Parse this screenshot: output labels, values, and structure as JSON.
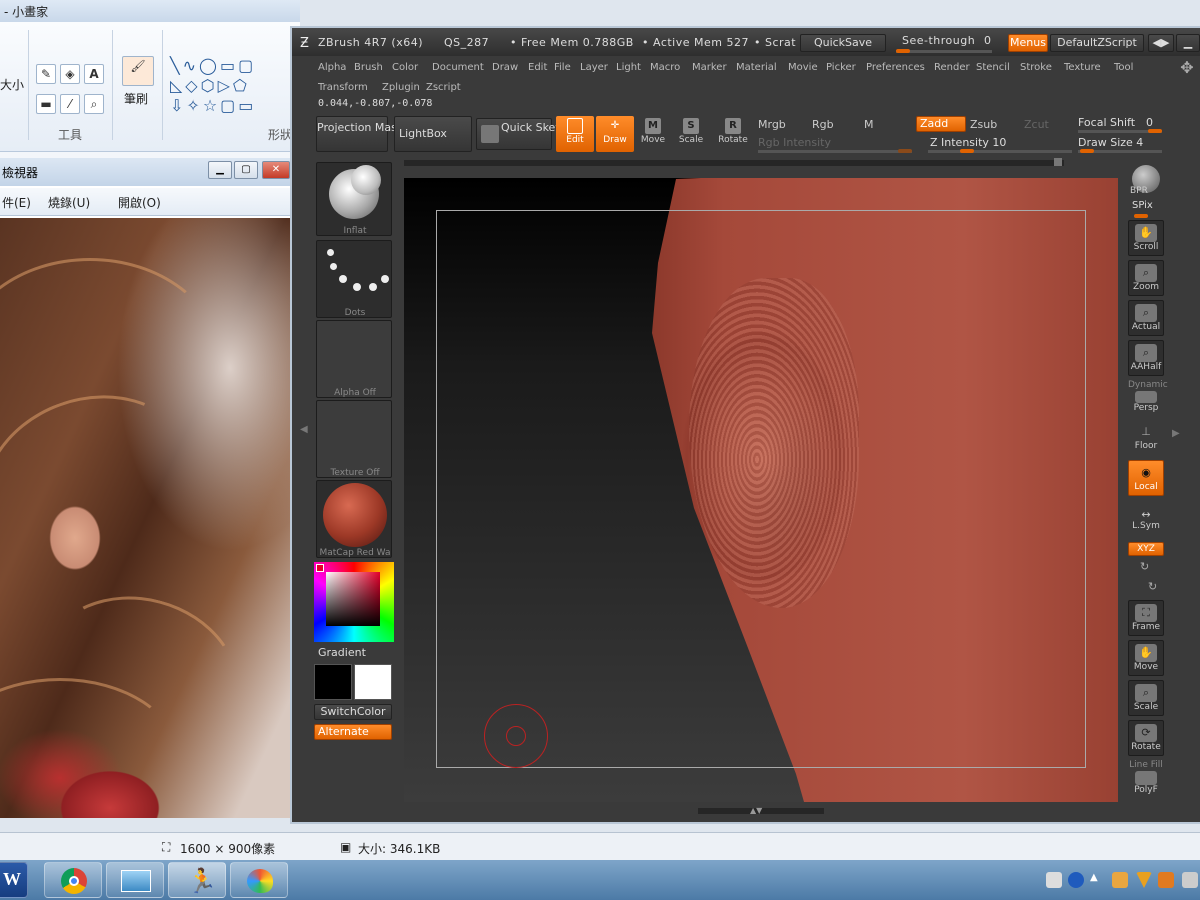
{
  "paint": {
    "title": "- 小畫家",
    "size_label": "大小",
    "brush_label": "筆刷",
    "tools_group": "工具",
    "shapes_group": "形狀"
  },
  "viewer": {
    "title": "檢視器",
    "menu": [
      "件(E)",
      "燒錄(U)",
      "開啟(O)"
    ]
  },
  "status": {
    "dimensions": "1600 × 900像素",
    "filesize": "大小: 346.1KB"
  },
  "zbrush": {
    "title": "ZBrush 4R7 (x64)",
    "qs": "QS_287",
    "free_mem": "• Free Mem 0.788GB",
    "active_mem": "• Active Mem 527",
    "scratch": "• Scrat",
    "quicksave": "QuickSave",
    "see_through": "See-through",
    "see_through_value": "0",
    "menus": "Menus",
    "default_script": "DefaultZScript",
    "menu_row1": [
      "Alpha",
      "Brush",
      "Color",
      "Document",
      "Draw",
      "Edit",
      "File",
      "Layer",
      "Light",
      "Macro",
      "Marker",
      "Material",
      "Movie",
      "Picker",
      "Preferences",
      "Render",
      "Stencil",
      "Stroke",
      "Texture",
      "Tool"
    ],
    "menu_row2": [
      "Transform",
      "Zplugin",
      "Zscript"
    ],
    "coords": "0.044,-0.807,-0.078",
    "projection_master": "Projection Master",
    "lightbox": "LightBox",
    "quick_sketch": "Quick Sketch",
    "tools": {
      "edit": "Edit",
      "draw": "Draw",
      "move": "Move",
      "scale": "Scale",
      "rotate": "Rotate"
    },
    "mrgb": "Mrgb",
    "rgb": "Rgb",
    "m": "M",
    "zadd": "Zadd",
    "zsub": "Zsub",
    "zcut": "Zcut",
    "rgb_intensity": "Rgb Intensity",
    "z_intensity": "Z Intensity 10",
    "focal_shift": "Focal Shift",
    "focal_shift_value": "0",
    "draw_size": "Draw Size 4",
    "left_tray": {
      "brush": "Inflat",
      "stroke": "Dots",
      "alpha": "Alpha Off",
      "texture": "Texture Off",
      "material": "MatCap Red Wa",
      "gradient": "Gradient",
      "switch_color": "SwitchColor",
      "alternate": "Alternate"
    },
    "right_shelf": {
      "bpr": "BPR",
      "spix": "SPix",
      "scroll": "Scroll",
      "zoom": "Zoom",
      "actual": "Actual",
      "aahalf": "AAHalf",
      "dynamic": "Dynamic",
      "persp": "Persp",
      "floor": "Floor",
      "local": "Local",
      "lsym": "L.Sym",
      "xyz": "XYZ",
      "frame": "Frame",
      "move": "Move",
      "scale": "Scale",
      "rotate": "Rotate",
      "line_fill": "Line Fill",
      "polyf": "PolyF"
    }
  },
  "colors": {
    "accent": "#e06200",
    "canvas_clay": "#a5493a"
  }
}
